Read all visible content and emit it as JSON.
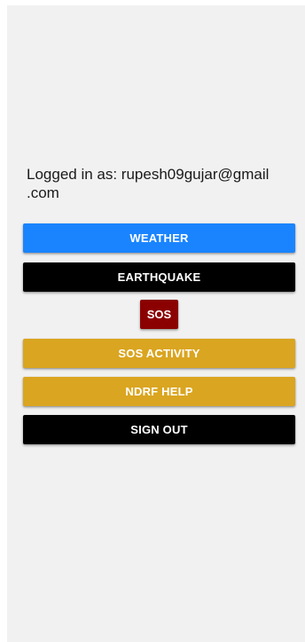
{
  "user": {
    "logged_in_text": "Logged in as: rupesh09gujar@gmail\n.com"
  },
  "buttons": {
    "weather": "WEATHER",
    "earthquake": "EARTHQUAKE",
    "sos": "SOS",
    "sos_activity": "SOS ACTIVITY",
    "ndrf_help": "NDRF HELP",
    "sign_out": "SIGN OUT"
  },
  "colors": {
    "weather": "#1a84ff",
    "earthquake": "#000000",
    "sos": "#8b0000",
    "sos_activity": "#daa520",
    "ndrf_help": "#daa520",
    "sign_out": "#000000",
    "background": "#f1f1f1"
  }
}
